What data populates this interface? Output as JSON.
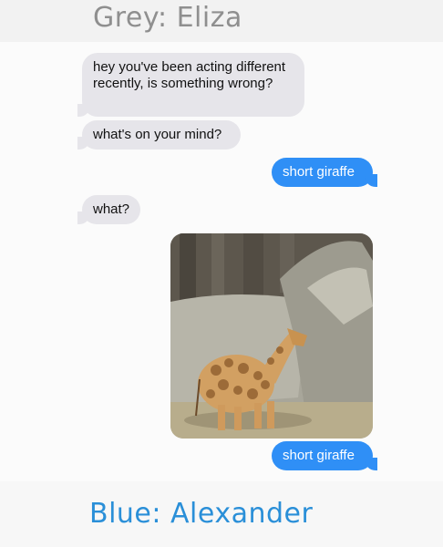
{
  "labels": {
    "top": "Grey: Eliza",
    "bottom": "Blue: Alexander"
  },
  "messages": [
    {
      "sender": "Eliza",
      "side": "left",
      "text": "hey you've been acting different recently, is something wrong?"
    },
    {
      "sender": "Eliza",
      "side": "left",
      "text": "what's on your mind?"
    },
    {
      "sender": "Alexander",
      "side": "right",
      "text": "short giraffe"
    },
    {
      "sender": "Eliza",
      "side": "left",
      "text": "what?"
    },
    {
      "sender": "Alexander",
      "side": "right",
      "type": "image",
      "icon": "short-giraffe-photo"
    },
    {
      "sender": "Alexander",
      "side": "right",
      "text": "short giraffe"
    }
  ],
  "colors": {
    "incoming_bubble": "#e6e5ea",
    "outgoing_bubble": "#2f8ff6",
    "top_label": "#8f8f8f",
    "bottom_label": "#2a8fd8"
  }
}
